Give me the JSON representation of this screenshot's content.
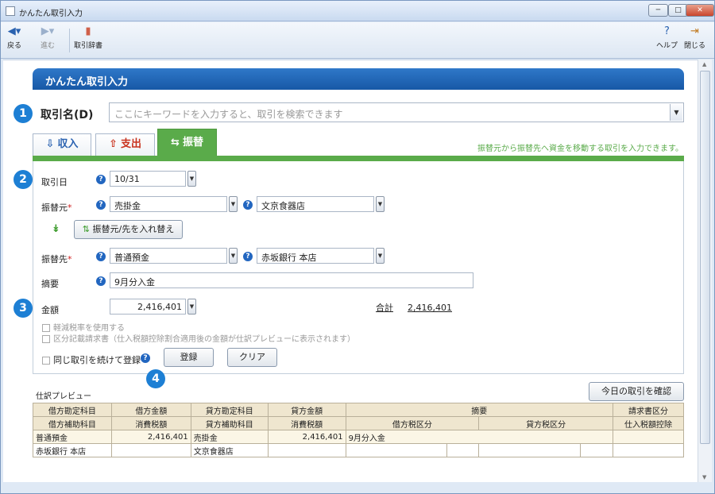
{
  "window": {
    "title": "かんたん取引入力"
  },
  "toolbar": {
    "back": "戻る",
    "forward": "進む",
    "dictionary": "取引辞書",
    "help": "ヘルプ",
    "close": "閉じる"
  },
  "header": {
    "title": "かんたん取引入力"
  },
  "badges": [
    "1",
    "2",
    "3",
    "4"
  ],
  "search": {
    "label": "取引名(D)",
    "placeholder": "ここにキーワードを入力すると、取引を検索できます"
  },
  "tabs": [
    {
      "label": "収入",
      "icon": "income-icon"
    },
    {
      "label": "支出",
      "icon": "expense-icon"
    },
    {
      "label": "振替",
      "icon": "transfer-icon",
      "active": true
    }
  ],
  "tab_note": "振替元から振替先へ資金を移動する取引を入力できます。",
  "form": {
    "date_label": "取引日",
    "date_value": "10/31",
    "from_label": "振替元",
    "from_account": "売掛金",
    "from_partner": "文京食器店",
    "swap_button": "振替元/先を入れ替え",
    "to_label": "振替先",
    "to_account": "普通預金",
    "to_partner": "赤坂銀行 本店",
    "memo_label": "摘要",
    "memo_value": "9月分入金",
    "amount_label": "金額",
    "amount_value": "2,416,401",
    "total_label": "合計",
    "total_value": "2,416,401",
    "reduced_tax": "軽減税率を使用する",
    "invoice": "区分記載請求書（仕入税額控除割合適用後の金額が仕訳プレビューに表示されます）",
    "repeat": "同じ取引を続けて登録",
    "register_button": "登録",
    "clear_button": "クリア"
  },
  "preview": {
    "label": "仕訳プレビュー",
    "confirm_button": "今日の取引を確認",
    "header1": [
      "借方勘定科目",
      "借方金額",
      "貸方勘定科目",
      "貸方金額",
      "摘要",
      "請求書区分"
    ],
    "header2": [
      "借方補助科目",
      "消費税額",
      "貸方補助科目",
      "消費税額",
      "借方税区分",
      "貸方税区分",
      "仕入税額控除"
    ],
    "row1": {
      "debit": "普通預金",
      "debit_amount": "2,416,401",
      "credit": "売掛金",
      "credit_amount": "2,416,401",
      "memo": "9月分入金"
    },
    "row2": {
      "debit_sub": "赤坂銀行 本店",
      "credit_sub": "文京食器店"
    }
  },
  "colors": {
    "header_blue": "#1d62b3",
    "tab_green": "#5aab4a",
    "badge_blue": "#1d7fd4",
    "required_red": "#d02020"
  }
}
